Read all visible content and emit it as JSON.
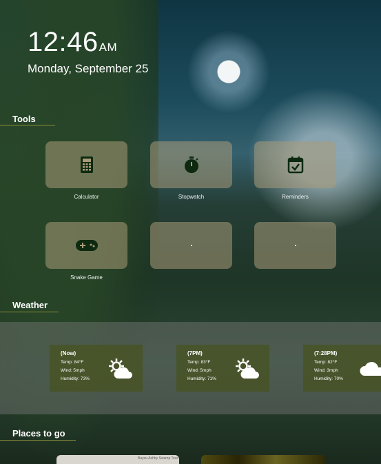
{
  "clock": {
    "time": "12:46",
    "ampm": "AM",
    "date": "Monday, September 25"
  },
  "sections": {
    "tools": "Tools",
    "weather": "Weather",
    "places": "Places to go"
  },
  "tools": [
    {
      "label": "Calculator",
      "icon": "calculator-icon"
    },
    {
      "label": "Stopwatch",
      "icon": "stopwatch-icon"
    },
    {
      "label": "Reminders",
      "icon": "calendar-check-icon"
    },
    {
      "label": "Snake Game",
      "icon": "gamepad-icon"
    },
    {
      "label": "",
      "icon": ""
    },
    {
      "label": "",
      "icon": ""
    }
  ],
  "weather": [
    {
      "when": "(Now)",
      "temp": "Temp: 84°F",
      "wind": "Wind: 5mph",
      "humidity": "Humidity: 73%",
      "icon": "partly-cloudy-icon"
    },
    {
      "when": "(7PM)",
      "temp": "Temp: 83°F",
      "wind": "Wind: 5mph",
      "humidity": "Humidity: 71%",
      "icon": "partly-cloudy-icon"
    },
    {
      "when": "(7:28PM)",
      "temp": "Temp: 82°F",
      "wind": "Wind: 3mph",
      "humidity": "Humidity: 70%",
      "icon": "cloud-icon"
    }
  ],
  "places": {
    "map_caption": "Bayou Ashby Swamp Tour"
  },
  "colors": {
    "accent_line": "#8d8d3a",
    "icon_dark": "#0d2a10",
    "tile_bg": "#aa9b78"
  }
}
